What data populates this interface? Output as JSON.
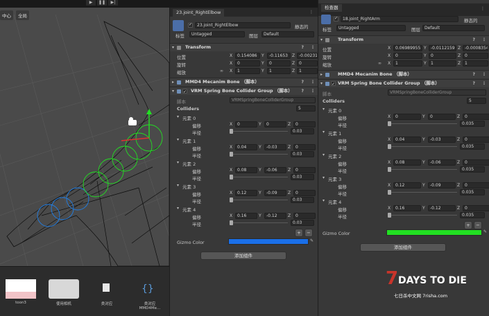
{
  "scene": {
    "toolbar": [
      "中心",
      "全局"
    ]
  },
  "project": {
    "assets": [
      "toon3",
      "使用相机",
      "类对应",
      "类对应MMD4Me..."
    ]
  },
  "left": {
    "tab": "23.joint_RightElbow",
    "name": "23.joint_RightElbow",
    "static": "静态的",
    "tag_label": "标签",
    "tag": "Untagged",
    "layer_label": "图层",
    "layer": "Default",
    "transform": {
      "title": "Transform",
      "pos_label": "位置",
      "rot_label": "旋转",
      "scale_label": "缩放",
      "pos": [
        "0.154086",
        "-0.11653",
        "-0.00231"
      ],
      "rot": [
        "0",
        "0",
        "0"
      ],
      "scale": [
        "1",
        "1",
        "1"
      ]
    },
    "mmd4": "MMD4 Mecanim Bone （脚本）",
    "vrm": "VRM Spring Bone Collider Group （脚本）",
    "script_label": "脚本",
    "script_value": "VRMSpringBoneColliderGroup",
    "colliders_label": "Colliders",
    "colliders_count": "5",
    "elements": [
      {
        "name": "元素 0",
        "offset": [
          "0",
          "0",
          "0"
        ],
        "radius": "0.03"
      },
      {
        "name": "元素 1",
        "offset": [
          "0.04",
          "-0.03",
          "0"
        ],
        "radius": "0.03"
      },
      {
        "name": "元素 2",
        "offset": [
          "0.08",
          "-0.06",
          "0"
        ],
        "radius": "0.03"
      },
      {
        "name": "元素 3",
        "offset": [
          "0.12",
          "-0.09",
          "0"
        ],
        "radius": "0.03"
      },
      {
        "name": "元素 4",
        "offset": [
          "0.16",
          "-0.12",
          "0"
        ],
        "radius": "0.03"
      }
    ],
    "offset_label": "偏移",
    "radius_label": "半径",
    "gizmo_label": "Gizmo Color",
    "gizmo_color": "#1a6fe8",
    "add_component": "添加组件"
  },
  "right": {
    "tab": "检查器",
    "name": "18.joint_RightArm",
    "static": "静态的",
    "tag_label": "标签",
    "tag": "Untagged",
    "layer_label": "图层",
    "layer": "Default",
    "transform": {
      "title": "Transform",
      "pos_label": "位置",
      "rot_label": "旋转",
      "scale_label": "缩放",
      "pos": [
        "0.06989955",
        "-0.0112159",
        "-0.0008354"
      ],
      "rot": [
        "0",
        "0",
        "0"
      ],
      "scale": [
        "1",
        "1",
        "1"
      ]
    },
    "mmd4": "MMD4 Mecanim Bone （脚本）",
    "vrm": "VRM Spring Bone Collider Group （脚本）",
    "script_label": "脚本",
    "script_value": "VRMSpringBoneColliderGroup",
    "colliders_label": "Colliders",
    "colliders_count": "5",
    "elements": [
      {
        "name": "元素 0",
        "offset": [
          "0",
          "0",
          "0"
        ],
        "radius": "0.035"
      },
      {
        "name": "元素 1",
        "offset": [
          "0.04",
          "-0.03",
          "0"
        ],
        "radius": "0.035"
      },
      {
        "name": "元素 2",
        "offset": [
          "0.08",
          "-0.06",
          "0"
        ],
        "radius": "0.035"
      },
      {
        "name": "元素 3",
        "offset": [
          "0.12",
          "-0.09",
          "0"
        ],
        "radius": "0.035"
      },
      {
        "name": "元素 4",
        "offset": [
          "0.16",
          "-0.12",
          "0"
        ],
        "radius": "0.035"
      }
    ],
    "offset_label": "偏移",
    "radius_label": "半径",
    "gizmo_label": "Gizmo Color",
    "gizmo_color": "#22e022",
    "add_component": "添加组件"
  },
  "watermark": {
    "logo": "7DAYS TO DIE",
    "site": "七日杀中文网 7risha.com"
  },
  "colors": {
    "accent": "#1a6fe8",
    "green": "#22e022",
    "wm_red": "#c9342a"
  }
}
